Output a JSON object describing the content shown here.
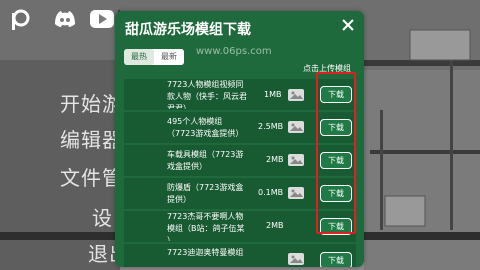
{
  "background_menu": {
    "items": [
      "开始游",
      "编辑器",
      "文件管",
      "设",
      "退出"
    ]
  },
  "modal": {
    "title": "甜瓜游乐场模组下载",
    "close_icon": "close-icon",
    "tabs": [
      {
        "label": "最热",
        "active": true
      },
      {
        "label": "最新",
        "active": false
      }
    ],
    "upload_label": "点击上传模组",
    "download_label": "下载",
    "mods": [
      {
        "lines": [
          "7723人物模组视频同",
          "款人物（快手：风云君",
          "君君）"
        ],
        "size": "1MB"
      },
      {
        "lines": [
          "495个人物模组",
          "（7723游戏盒提供）"
        ],
        "size": "2.5MB"
      },
      {
        "lines": [
          "车载具模组（7723游",
          "戏盒提供）"
        ],
        "size": "2MB"
      },
      {
        "lines": [
          "防爆盾（7723游戏盒",
          "提供）"
        ],
        "size": "0.1MB"
      },
      {
        "lines": [
          "7723杰哥不要啊人物",
          "模组（B站：鸽子伍某",
          "）"
        ],
        "size": "2MB"
      },
      {
        "lines": [
          "7723迪迦奥特曼模组"
        ],
        "size": ""
      }
    ]
  },
  "watermark": "www.06ps.com",
  "colors": {
    "modal_bg": "#1f6a3c",
    "row_bg": "#185a32",
    "highlight": "#e02020"
  }
}
